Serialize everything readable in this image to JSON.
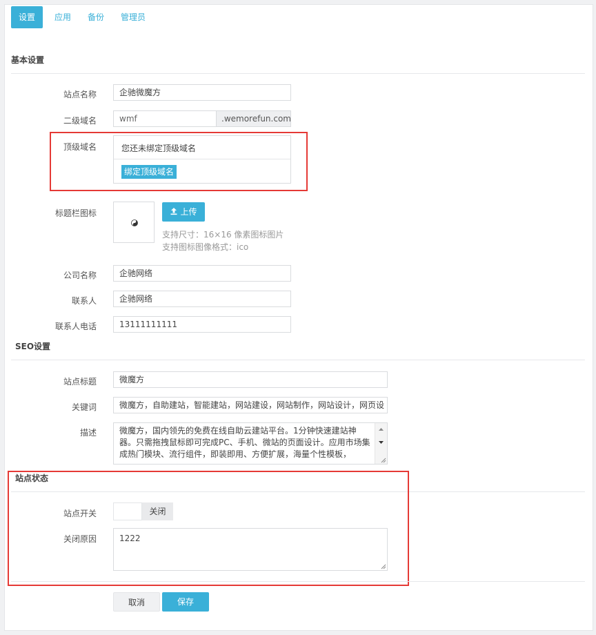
{
  "tabs": [
    {
      "label": "设置",
      "active": true
    },
    {
      "label": "应用",
      "active": false
    },
    {
      "label": "备份",
      "active": false
    },
    {
      "label": "管理员",
      "active": false
    }
  ],
  "basic": {
    "title": "基本设置",
    "site_name_label": "站点名称",
    "site_name_value": "企驰微魔方",
    "subdomain_label": "二级域名",
    "subdomain_value": "wmf",
    "subdomain_suffix": ".wemorefun.com",
    "topdomain_label": "顶级域名",
    "topdomain_message": "您还未绑定顶级域名",
    "topdomain_bind_button": "绑定顶级域名",
    "favicon_label": "标题栏图标",
    "upload_button": "上传",
    "favicon_hint_size": "支持尺寸：16×16 像素图标图片",
    "favicon_hint_format": "支持图标图像格式：ico",
    "company_label": "公司名称",
    "company_value": "企驰网络",
    "contact_label": "联系人",
    "contact_value": "企驰网络",
    "phone_label": "联系人电话",
    "phone_value": "13111111111"
  },
  "seo": {
    "title": "SEO设置",
    "site_title_label": "站点标题",
    "site_title_value": "微魔方",
    "keywords_label": "关键词",
    "keywords_value": "微魔方，自助建站，智能建站，网站建设，网站制作，网站设计，网页设",
    "description_label": "描述",
    "description_value": "微魔方，国内领先的免费在线自助云建站平台。1分钟快速建站神器。只需拖拽鼠标即可完成PC、手机、微站的页面设计。应用市场集成热门模块、流行组件，即装即用、方便扩展，海量个性模板，"
  },
  "status": {
    "title": "站点状态",
    "switch_label": "站点开关",
    "switch_state": "关闭",
    "close_reason_label": "关闭原因",
    "close_reason_value": "1222"
  },
  "actions": {
    "cancel": "取消",
    "save": "保存"
  },
  "colors": {
    "accent": "#3ab0d8",
    "highlight_border": "#e53935"
  }
}
